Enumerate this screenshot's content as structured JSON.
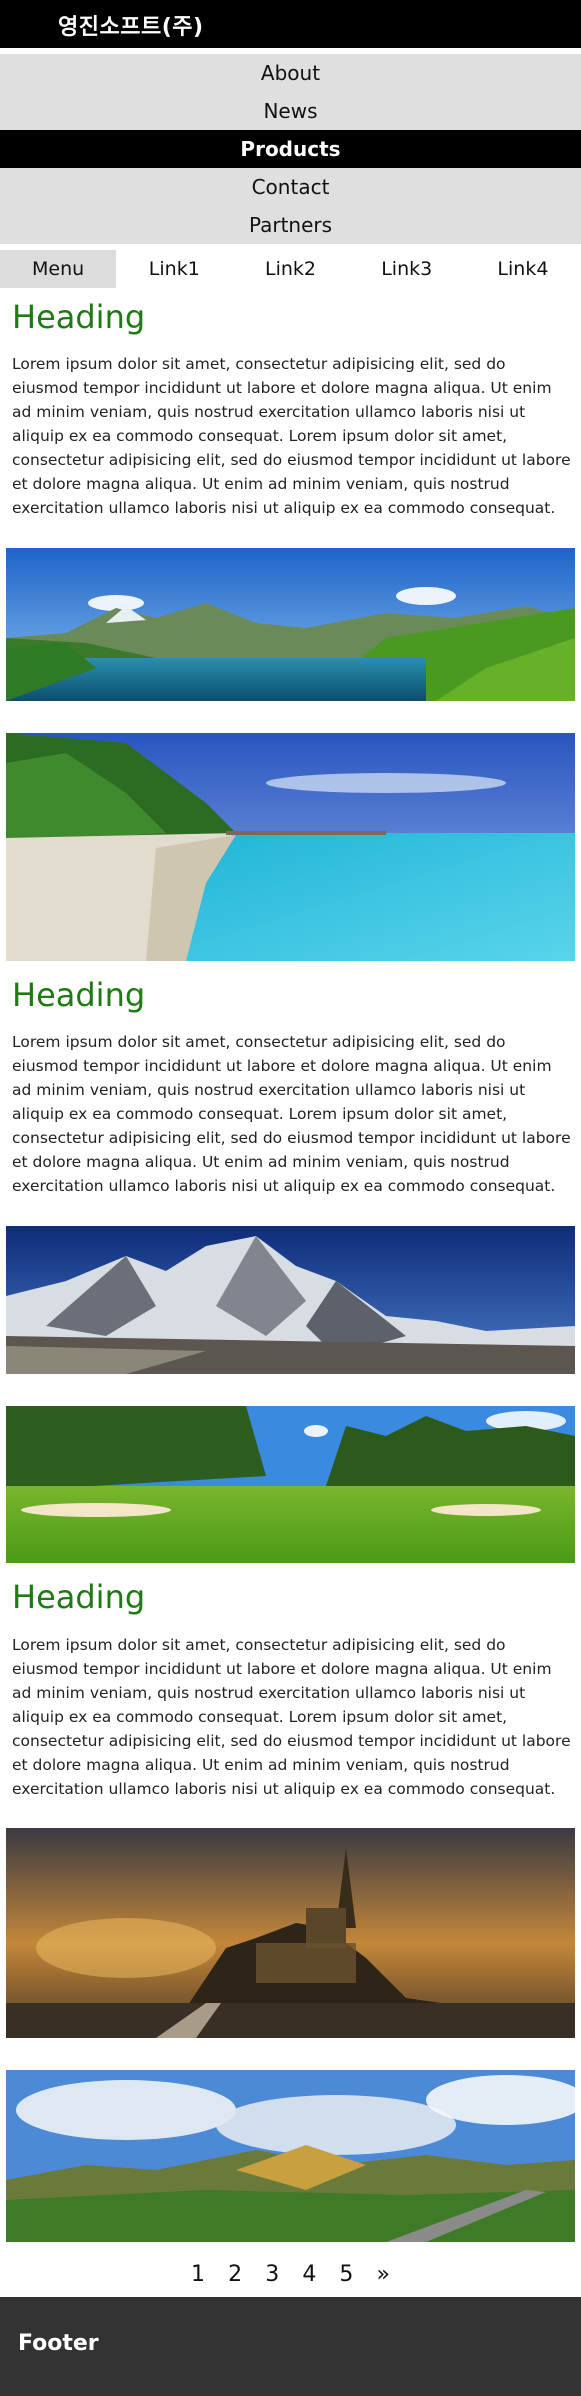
{
  "brand": {
    "title": "영진소프트(주)"
  },
  "nav": {
    "items": [
      {
        "label": "About"
      },
      {
        "label": "News"
      },
      {
        "label": "Products"
      },
      {
        "label": "Contact"
      },
      {
        "label": "Partners"
      }
    ],
    "active_label": "Products"
  },
  "subnav": {
    "items": [
      {
        "label": "Menu"
      },
      {
        "label": "Link1"
      },
      {
        "label": "Link2"
      },
      {
        "label": "Link3"
      },
      {
        "label": "Link4"
      }
    ]
  },
  "sections": [
    {
      "heading": "Heading",
      "body": "Lorem ipsum dolor sit amet, consectetur adipisicing elit, sed do eiusmod tempor incididunt ut labore et dolore magna aliqua. Ut enim ad minim veniam, quis nostrud exercitation ullamco laboris nisi ut aliquip ex ea commodo consequat. Lorem ipsum dolor sit amet, consectetur adipisicing elit, sed do eiusmod tempor incididunt ut labore et dolore magna aliqua. Ut enim ad minim veniam, quis nostrud exercitation ullamco laboris nisi ut aliquip ex ea commodo consequat."
    },
    {
      "heading": "Heading",
      "body": "Lorem ipsum dolor sit amet, consectetur adipisicing elit, sed do eiusmod tempor incididunt ut labore et dolore magna aliqua. Ut enim ad minim veniam, quis nostrud exercitation ullamco laboris nisi ut aliquip ex ea commodo consequat. Lorem ipsum dolor sit amet, consectetur adipisicing elit, sed do eiusmod tempor incididunt ut labore et dolore magna aliqua. Ut enim ad minim veniam, quis nostrud exercitation ullamco laboris nisi ut aliquip ex ea commodo consequat."
    },
    {
      "heading": "Heading",
      "body": "Lorem ipsum dolor sit amet, consectetur adipisicing elit, sed do eiusmod tempor incididunt ut labore et dolore magna aliqua. Ut enim ad minim veniam, quis nostrud exercitation ullamco laboris nisi ut aliquip ex ea commodo consequat. Lorem ipsum dolor sit amet, consectetur adipisicing elit, sed do eiusmod tempor incididunt ut labore et dolore magna aliqua. Ut enim ad minim veniam, quis nostrud exercitation ullamco laboris nisi ut aliquip ex ea commodo consequat."
    }
  ],
  "photos": [
    {
      "subject": "mountain-lake"
    },
    {
      "subject": "tropical-beach"
    },
    {
      "subject": "snowy-mountains"
    },
    {
      "subject": "golf-course"
    },
    {
      "subject": "castle-sunset"
    },
    {
      "subject": "valley-clouds"
    }
  ],
  "pagination": {
    "pages": [
      "1",
      "2",
      "3",
      "4",
      "5"
    ],
    "next_label": "»"
  },
  "footer": {
    "text": "Footer"
  },
  "colors": {
    "header_bg": "#000000",
    "nav_bg": "#dfdfdf",
    "nav_active_bg": "#000000",
    "heading": "#1e7a12",
    "footer_bg": "#333333"
  }
}
